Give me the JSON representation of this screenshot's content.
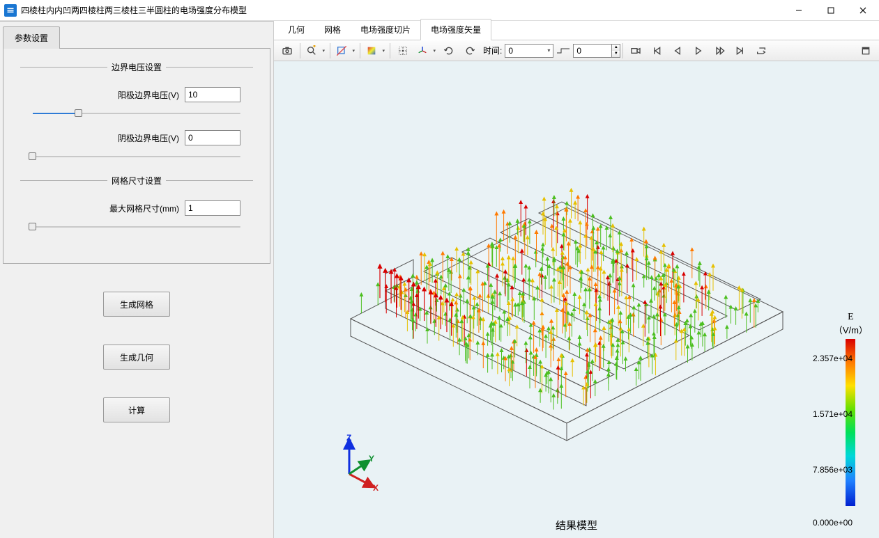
{
  "window": {
    "title": "四棱柱内内凹两四棱柱两三棱柱三半圆柱的电场强度分布模型"
  },
  "sidebar": {
    "tab_label": "参数设置",
    "group_voltage_title": "边界电压设置",
    "anode_label": "阳极边界电压(V)",
    "anode_value": "10",
    "cathode_label": "阴极边界电压(V)",
    "cathode_value": "0",
    "group_mesh_title": "网格尺寸设置",
    "max_mesh_label": "最大网格尺寸(mm)",
    "max_mesh_value": "1",
    "btn_generate_mesh": "生成网格",
    "btn_generate_geometry": "生成几何",
    "btn_compute": "计算"
  },
  "right_tabs": {
    "t0": "几何",
    "t1": "网格",
    "t2": "电场强度切片",
    "t3": "电场强度矢量"
  },
  "toolbar": {
    "time_label": "时间:",
    "time_value": "0",
    "frame_value": "0"
  },
  "legend": {
    "title": "E",
    "unit": "（V/m）",
    "tick0": "2.357e+04",
    "tick1": "1.571e+04",
    "tick2": "7.856e+03",
    "tick3": "0.000e+00"
  },
  "viewport": {
    "caption": "结果模型",
    "axes": {
      "x": "X",
      "y": "Y",
      "z": "Z"
    }
  }
}
